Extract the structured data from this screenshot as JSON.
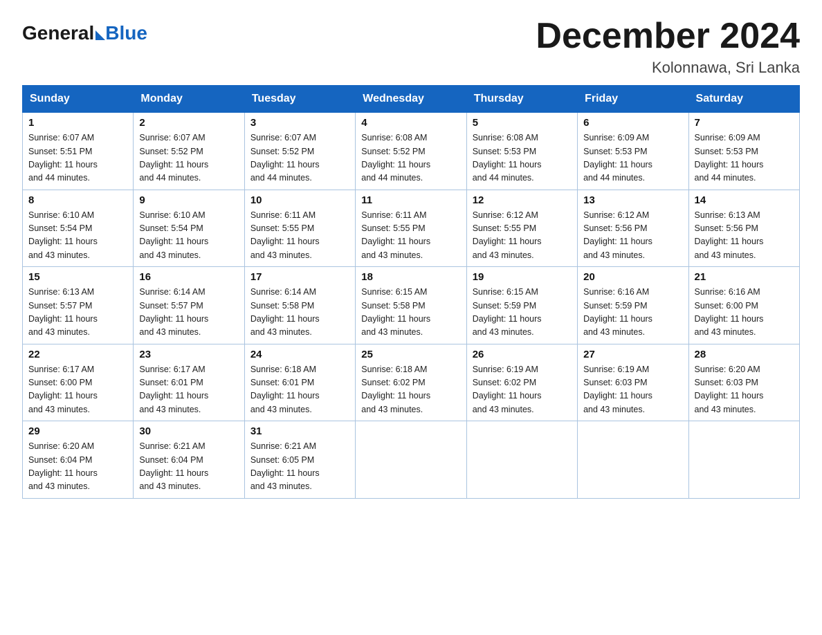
{
  "header": {
    "logo_general": "General",
    "logo_blue": "Blue",
    "month_year": "December 2024",
    "location": "Kolonnawa, Sri Lanka"
  },
  "days_of_week": [
    "Sunday",
    "Monday",
    "Tuesday",
    "Wednesday",
    "Thursday",
    "Friday",
    "Saturday"
  ],
  "weeks": [
    [
      {
        "day": "1",
        "sunrise": "6:07 AM",
        "sunset": "5:51 PM",
        "daylight": "11 hours and 44 minutes."
      },
      {
        "day": "2",
        "sunrise": "6:07 AM",
        "sunset": "5:52 PM",
        "daylight": "11 hours and 44 minutes."
      },
      {
        "day": "3",
        "sunrise": "6:07 AM",
        "sunset": "5:52 PM",
        "daylight": "11 hours and 44 minutes."
      },
      {
        "day": "4",
        "sunrise": "6:08 AM",
        "sunset": "5:52 PM",
        "daylight": "11 hours and 44 minutes."
      },
      {
        "day": "5",
        "sunrise": "6:08 AM",
        "sunset": "5:53 PM",
        "daylight": "11 hours and 44 minutes."
      },
      {
        "day": "6",
        "sunrise": "6:09 AM",
        "sunset": "5:53 PM",
        "daylight": "11 hours and 44 minutes."
      },
      {
        "day": "7",
        "sunrise": "6:09 AM",
        "sunset": "5:53 PM",
        "daylight": "11 hours and 44 minutes."
      }
    ],
    [
      {
        "day": "8",
        "sunrise": "6:10 AM",
        "sunset": "5:54 PM",
        "daylight": "11 hours and 43 minutes."
      },
      {
        "day": "9",
        "sunrise": "6:10 AM",
        "sunset": "5:54 PM",
        "daylight": "11 hours and 43 minutes."
      },
      {
        "day": "10",
        "sunrise": "6:11 AM",
        "sunset": "5:55 PM",
        "daylight": "11 hours and 43 minutes."
      },
      {
        "day": "11",
        "sunrise": "6:11 AM",
        "sunset": "5:55 PM",
        "daylight": "11 hours and 43 minutes."
      },
      {
        "day": "12",
        "sunrise": "6:12 AM",
        "sunset": "5:55 PM",
        "daylight": "11 hours and 43 minutes."
      },
      {
        "day": "13",
        "sunrise": "6:12 AM",
        "sunset": "5:56 PM",
        "daylight": "11 hours and 43 minutes."
      },
      {
        "day": "14",
        "sunrise": "6:13 AM",
        "sunset": "5:56 PM",
        "daylight": "11 hours and 43 minutes."
      }
    ],
    [
      {
        "day": "15",
        "sunrise": "6:13 AM",
        "sunset": "5:57 PM",
        "daylight": "11 hours and 43 minutes."
      },
      {
        "day": "16",
        "sunrise": "6:14 AM",
        "sunset": "5:57 PM",
        "daylight": "11 hours and 43 minutes."
      },
      {
        "day": "17",
        "sunrise": "6:14 AM",
        "sunset": "5:58 PM",
        "daylight": "11 hours and 43 minutes."
      },
      {
        "day": "18",
        "sunrise": "6:15 AM",
        "sunset": "5:58 PM",
        "daylight": "11 hours and 43 minutes."
      },
      {
        "day": "19",
        "sunrise": "6:15 AM",
        "sunset": "5:59 PM",
        "daylight": "11 hours and 43 minutes."
      },
      {
        "day": "20",
        "sunrise": "6:16 AM",
        "sunset": "5:59 PM",
        "daylight": "11 hours and 43 minutes."
      },
      {
        "day": "21",
        "sunrise": "6:16 AM",
        "sunset": "6:00 PM",
        "daylight": "11 hours and 43 minutes."
      }
    ],
    [
      {
        "day": "22",
        "sunrise": "6:17 AM",
        "sunset": "6:00 PM",
        "daylight": "11 hours and 43 minutes."
      },
      {
        "day": "23",
        "sunrise": "6:17 AM",
        "sunset": "6:01 PM",
        "daylight": "11 hours and 43 minutes."
      },
      {
        "day": "24",
        "sunrise": "6:18 AM",
        "sunset": "6:01 PM",
        "daylight": "11 hours and 43 minutes."
      },
      {
        "day": "25",
        "sunrise": "6:18 AM",
        "sunset": "6:02 PM",
        "daylight": "11 hours and 43 minutes."
      },
      {
        "day": "26",
        "sunrise": "6:19 AM",
        "sunset": "6:02 PM",
        "daylight": "11 hours and 43 minutes."
      },
      {
        "day": "27",
        "sunrise": "6:19 AM",
        "sunset": "6:03 PM",
        "daylight": "11 hours and 43 minutes."
      },
      {
        "day": "28",
        "sunrise": "6:20 AM",
        "sunset": "6:03 PM",
        "daylight": "11 hours and 43 minutes."
      }
    ],
    [
      {
        "day": "29",
        "sunrise": "6:20 AM",
        "sunset": "6:04 PM",
        "daylight": "11 hours and 43 minutes."
      },
      {
        "day": "30",
        "sunrise": "6:21 AM",
        "sunset": "6:04 PM",
        "daylight": "11 hours and 43 minutes."
      },
      {
        "day": "31",
        "sunrise": "6:21 AM",
        "sunset": "6:05 PM",
        "daylight": "11 hours and 43 minutes."
      },
      null,
      null,
      null,
      null
    ]
  ],
  "labels": {
    "sunrise": "Sunrise:",
    "sunset": "Sunset:",
    "daylight": "Daylight:"
  }
}
